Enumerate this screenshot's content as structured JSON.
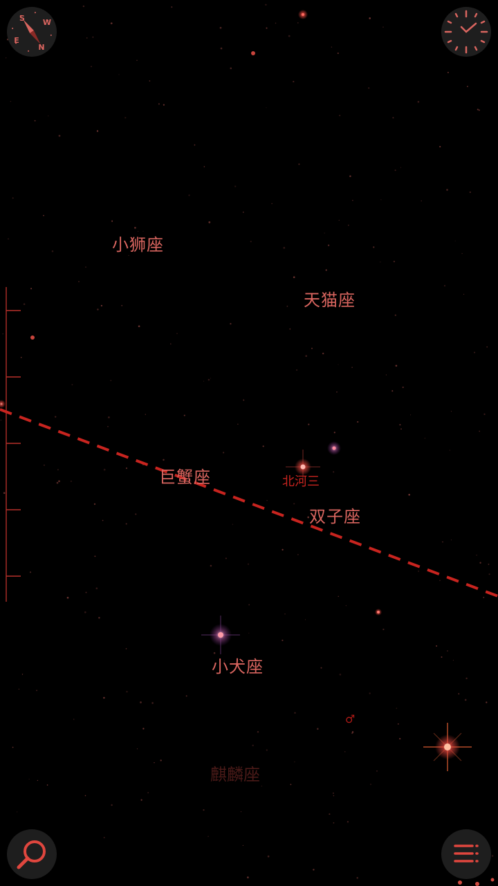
{
  "constellations": [
    {
      "name": "小狮座"
    },
    {
      "name": "天猫座"
    },
    {
      "name": "巨蟹座"
    },
    {
      "name": "双子座"
    },
    {
      "name": "小犬座"
    },
    {
      "name": "麒麟座"
    }
  ],
  "stars": [
    {
      "name": "北河三"
    }
  ],
  "planet": {
    "symbol": "♂"
  },
  "compass": {
    "n": "N",
    "s": "S",
    "e": "E",
    "w": "W"
  },
  "colors": {
    "accent": "#d9655f",
    "ecliptic": "#c8241f",
    "button_bg": "#1e1e1e",
    "background": "#000000"
  }
}
